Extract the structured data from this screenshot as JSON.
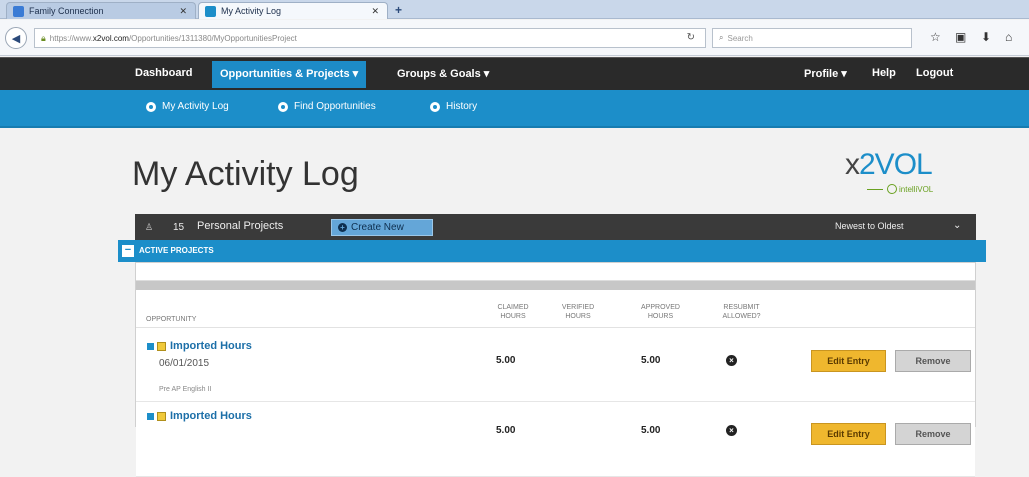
{
  "browser": {
    "tabs": [
      {
        "label": "Family Connection",
        "favicon_color": "#3a7bd5"
      },
      {
        "label": "My Activity Log",
        "favicon_color": "#1c8ec9"
      }
    ],
    "url_prefix": "https://www.",
    "url_host": "x2vol.com",
    "url_path": "/Opportunities/1311380/MyOpportunitiesProject",
    "search_placeholder": "Search"
  },
  "site_nav": {
    "left": [
      "Dashboard",
      "Opportunities & Projects ▾",
      "Groups & Goals ▾"
    ],
    "right": [
      "Profile ▾",
      "Help",
      "Logout"
    ]
  },
  "subnav": [
    "My Activity Log",
    "Find Opportunities",
    "History"
  ],
  "page_title": "My Activity Log",
  "logo": {
    "x": "x",
    "main": "2VOL",
    "sub": "intelliVOL"
  },
  "panel": {
    "count": "15",
    "label": "Personal Projects",
    "create_label": "Create New",
    "sort_label": "Newest to Oldest",
    "section_label": "ACTIVE PROJECTS"
  },
  "columns": {
    "opportunity": "OPPORTUNITY",
    "claimed": [
      "CLAIMED",
      "HOURS"
    ],
    "verified": [
      "VERIFIED",
      "HOURS"
    ],
    "approved": [
      "APPROVED",
      "HOURS"
    ],
    "resubmit": [
      "RESUBMIT",
      "ALLOWED?"
    ]
  },
  "rows": [
    {
      "title": "Imported Hours",
      "date": "06/01/2015",
      "sub": "Pre AP English II",
      "claimed": "5.00",
      "approved": "5.00",
      "edit": "Edit Entry",
      "remove": "Remove"
    },
    {
      "title": "Imported Hours",
      "date": "",
      "sub": "",
      "claimed": "5.00",
      "approved": "5.00",
      "edit": "Edit Entry",
      "remove": "Remove"
    }
  ],
  "colors": {
    "accent": "#1c8ec9",
    "nav_dark": "#2a2a2a",
    "edit_button": "#efb72e"
  }
}
